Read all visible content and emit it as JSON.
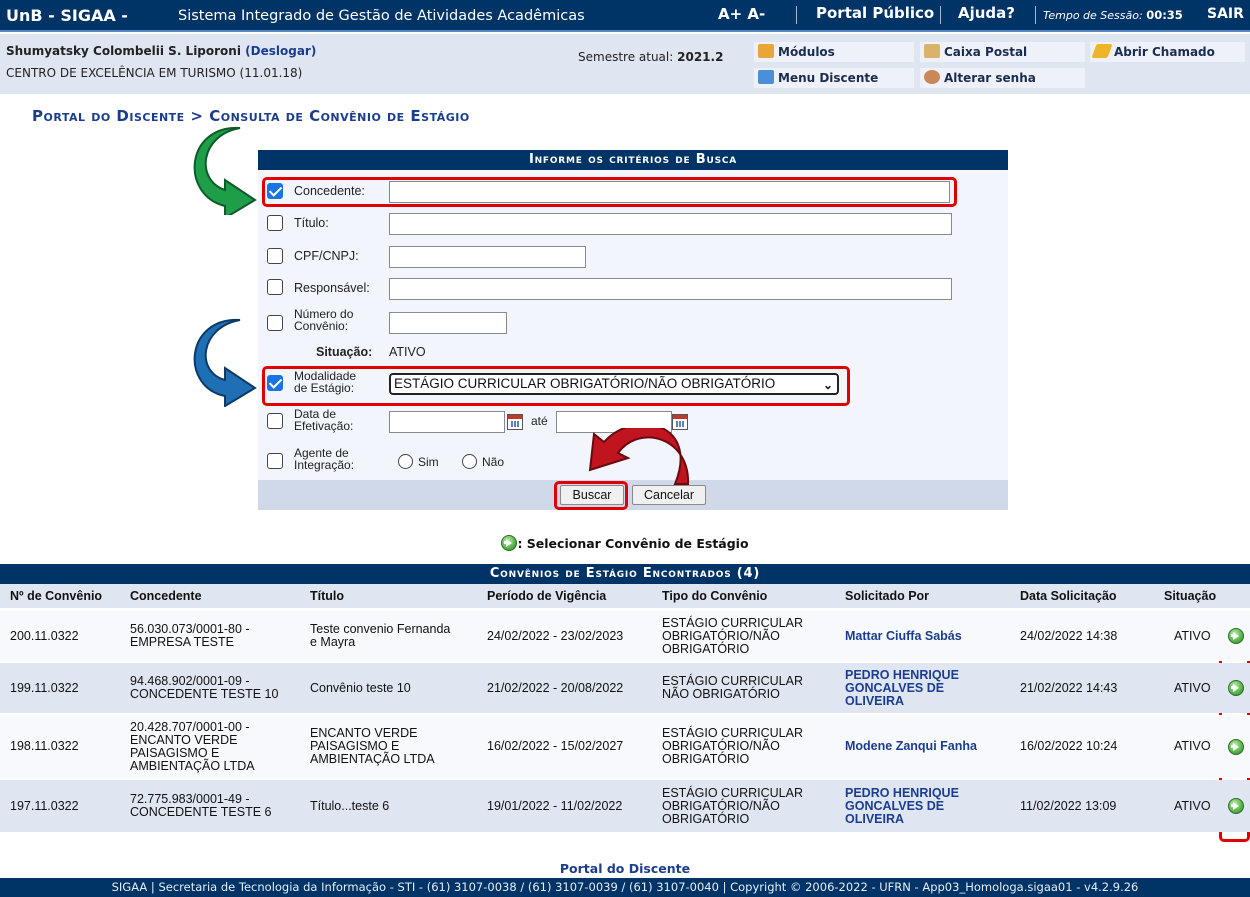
{
  "topbar": {
    "brand": "UnB - SIGAA -",
    "subtitle": "Sistema Integrado de Gestão de Atividades Acadêmicas",
    "font_controls": "A+ A-",
    "portal_publico": "Portal Público",
    "ajuda": "Ajuda?",
    "session_label": "Tempo de Sessão:",
    "session_time": "00:35",
    "sair": "SAIR"
  },
  "infobar": {
    "user_name": "Shumyatsky Colombelii S. Liporoni",
    "logout": "(Deslogar)",
    "unit": "CENTRO DE EXCELÊNCIA EM TURISMO (11.01.18)",
    "semester_label": "Semestre atual:",
    "semester": "2021.2",
    "menu": {
      "modulos": "Módulos",
      "caixa_postal": "Caixa Postal",
      "abrir_chamado": "Abrir Chamado",
      "menu_discente": "Menu Discente",
      "alterar_senha": "Alterar senha"
    }
  },
  "breadcrumb": "Portal do Discente > Consulta de Convênio de Estágio",
  "form": {
    "title": "Informe os critérios de Busca",
    "concedente_label": "Concedente:",
    "titulo_label": "Título:",
    "cpf_label": "CPF/CNPJ:",
    "responsavel_label": "Responsável:",
    "numero_label_1": "Número do",
    "numero_label_2": "Convênio:",
    "situacao_label": "Situação:",
    "situacao_value": "ATIVO",
    "modalidade_label_1": "Modalidade",
    "modalidade_label_2": "de Estágio:",
    "modalidade_value": "ESTÁGIO CURRICULAR OBRIGATÓRIO/NÃO OBRIGATÓRIO",
    "data_label_1": "Data de",
    "data_label_2": "Efetivação:",
    "ate": "até",
    "agente_label_1": "Agente de",
    "agente_label_2": "Integração:",
    "sim": "Sim",
    "nao": "Não",
    "buscar": "Buscar",
    "cancelar": "Cancelar",
    "concedente_checked": true,
    "modalidade_checked": true
  },
  "legend": ": Selecionar Convênio de Estágio",
  "results": {
    "title": "Convênios de Estágio Encontrados (4)",
    "columns": [
      "Nº de Convênio",
      "Concedente",
      "Título",
      "Período de Vigência",
      "Tipo do Convênio",
      "Solicitado Por",
      "Data Solicitação",
      "Situação"
    ],
    "rows": [
      {
        "numero": "200.11.0322",
        "concedente": [
          "56.030.073/0001-80 -",
          "EMPRESA TESTE"
        ],
        "titulo": [
          "Teste convenio Fernanda",
          "e Mayra"
        ],
        "periodo": "24/02/2022 - 23/02/2023",
        "tipo": [
          "ESTÁGIO CURRICULAR",
          "OBRIGATÓRIO/NÃO",
          "OBRIGATÓRIO"
        ],
        "solicitado": [
          "Mattar Ciuffa Sabás"
        ],
        "data": "24/02/2022 14:38",
        "situacao": "ATIVO"
      },
      {
        "numero": "199.11.0322",
        "concedente": [
          "94.468.902/0001-09 -",
          "CONCEDENTE TESTE 10"
        ],
        "titulo": [
          "Convênio teste 10"
        ],
        "periodo": "21/02/2022 - 20/08/2022",
        "tipo": [
          "ESTÁGIO CURRICULAR",
          "NÃO OBRIGATÓRIO"
        ],
        "solicitado": [
          "PEDRO HENRIQUE",
          "GONCALVES DE",
          "OLIVEIRA"
        ],
        "data": "21/02/2022 14:43",
        "situacao": "ATIVO"
      },
      {
        "numero": "198.11.0322",
        "concedente": [
          "20.428.707/0001-00 -",
          "ENCANTO VERDE",
          "PAISAGISMO E",
          "AMBIENTAÇÃO LTDA"
        ],
        "titulo": [
          "ENCANTO VERDE",
          "PAISAGISMO E",
          "AMBIENTAÇÃO LTDA"
        ],
        "periodo": "16/02/2022 - 15/02/2027",
        "tipo": [
          "ESTÁGIO CURRICULAR",
          "OBRIGATÓRIO/NÃO",
          "OBRIGATÓRIO"
        ],
        "solicitado": [
          "Modene Zanqui Fanha"
        ],
        "data": "16/02/2022 10:24",
        "situacao": "ATIVO"
      },
      {
        "numero": "197.11.0322",
        "concedente": [
          "72.775.983/0001-49 -",
          "CONCEDENTE TESTE 6"
        ],
        "titulo": [
          "Título...teste 6"
        ],
        "periodo": "19/01/2022 - 11/02/2022",
        "tipo": [
          "ESTÁGIO CURRICULAR",
          "OBRIGATÓRIO/NÃO",
          "OBRIGATÓRIO"
        ],
        "solicitado": [
          "PEDRO HENRIQUE",
          "GONCALVES DE",
          "OLIVEIRA"
        ],
        "data": "11/02/2022 13:09",
        "situacao": "ATIVO"
      }
    ]
  },
  "footer": {
    "portal_link": "Portal do Discente",
    "text": "SIGAA | Secretaria de Tecnologia da Informação - STI - (61) 3107-0038 / (61) 3107-0039 / (61) 3107-0040 | Copyright © 2006-2022 - UFRN - App03_Homologa.sigaa01 - v4.2.9.26"
  },
  "colors": {
    "header_navy": "#003366",
    "highlight_red": "#e00000",
    "arrow_green": "#1f9e4a",
    "arrow_blue": "#1f6fb5",
    "arrow_red": "#c0141e",
    "link_blue": "#1a3d8f"
  }
}
